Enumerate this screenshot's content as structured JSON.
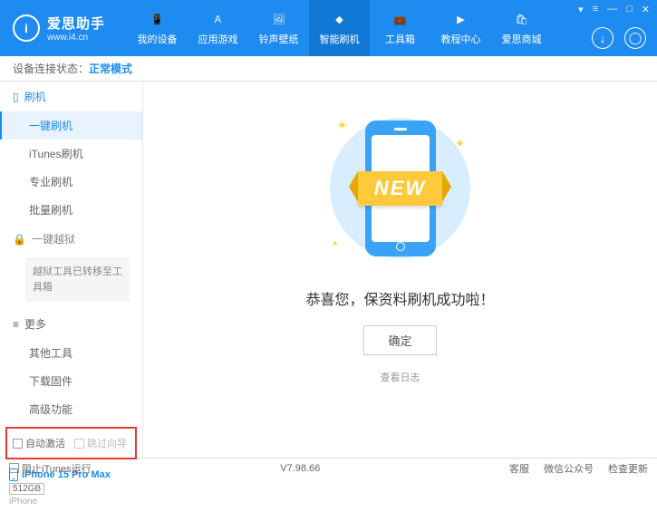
{
  "header": {
    "app_name": "爱思助手",
    "url": "www.i4.cn",
    "nav": [
      {
        "label": "我的设备"
      },
      {
        "label": "应用游戏"
      },
      {
        "label": "铃声壁纸"
      },
      {
        "label": "智能刷机"
      },
      {
        "label": "工具箱"
      },
      {
        "label": "教程中心"
      },
      {
        "label": "爱思商城"
      }
    ],
    "win": {
      "menu": "▾",
      "tray": "≡",
      "min": "—",
      "max": "□",
      "close": "✕"
    }
  },
  "status": {
    "label": "设备连接状态：",
    "mode": "正常模式"
  },
  "sidebar": {
    "sec_flash": "刷机",
    "items_flash": [
      "一键刷机",
      "iTunes刷机",
      "专业刷机",
      "批量刷机"
    ],
    "sec_jail": "一键越狱",
    "jail_note": "越狱工具已转移至工具箱",
    "sec_more": "更多",
    "items_more": [
      "其他工具",
      "下载固件",
      "高级功能"
    ],
    "checkbox1": "自动激活",
    "checkbox2": "跳过向导",
    "device": {
      "name": "iPhone 15 Pro Max",
      "storage": "512GB",
      "type": "iPhone"
    }
  },
  "main": {
    "ribbon": "NEW",
    "success": "恭喜您，保资料刷机成功啦！",
    "ok": "确定",
    "log": "查看日志"
  },
  "footer": {
    "block_itunes": "阻止iTunes运行",
    "version": "V7.98.66",
    "links": [
      "客服",
      "微信公众号",
      "检查更新"
    ]
  }
}
